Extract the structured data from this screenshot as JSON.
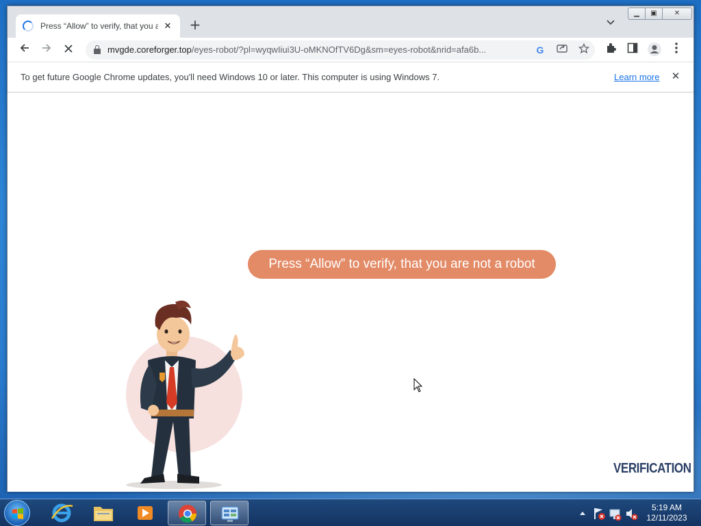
{
  "browser": {
    "tab": {
      "title": "Press “Allow” to verify, that you a"
    },
    "address": {
      "host": "mvgde.coreforger.top",
      "path": "/eyes-robot/?pl=wyqwIiui3U-oMKNOfTV6Dg&sm=eyes-robot&nrid=afa6b..."
    },
    "infobar": {
      "message": "To get future Google Chrome updates, you'll need Windows 10 or later. This computer is using Windows 7.",
      "link": "Learn more"
    }
  },
  "page": {
    "bubble_text": "Press “Allow” to verify, that you are not a robot",
    "badge": "VERIFICATION"
  },
  "taskbar": {
    "items": [
      "start-button",
      "internet-explorer",
      "file-explorer",
      "media-player",
      "google-chrome",
      "control-panel"
    ],
    "clock": {
      "time": "5:19 AM",
      "date": "12/11/2023"
    }
  },
  "colors": {
    "bubble": "#e38a66",
    "badge": "#2a3f66",
    "link": "#1a73e8"
  }
}
